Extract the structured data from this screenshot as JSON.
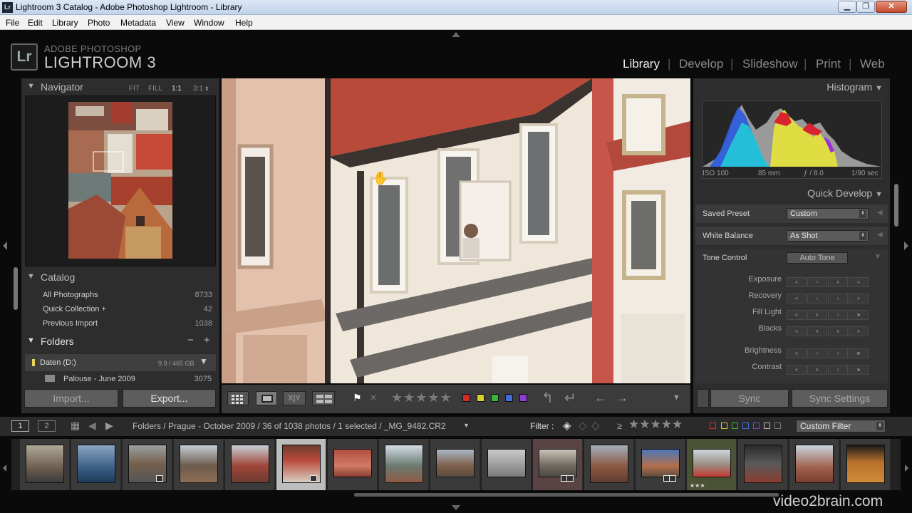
{
  "window": {
    "title": "Lightroom 3 Catalog - Adobe Photoshop Lightroom - Library",
    "app_icon": "Lr",
    "controls": [
      "minimize",
      "maximize",
      "close"
    ]
  },
  "menu": [
    "File",
    "Edit",
    "Library",
    "Photo",
    "Metadata",
    "View",
    "Window",
    "Help"
  ],
  "identity": {
    "badge": "Lr",
    "line1": "ADOBE PHOTOSHOP",
    "line2": "LIGHTROOM 3"
  },
  "modules": [
    "Library",
    "Develop",
    "Slideshow",
    "Print",
    "Web"
  ],
  "active_module": "Library",
  "navigator": {
    "title": "Navigator",
    "options": [
      "FIT",
      "FILL",
      "1:1",
      "3:1"
    ],
    "active_option": "1:1"
  },
  "catalog": {
    "title": "Catalog",
    "items": [
      {
        "label": "All Photographs",
        "count": "8733"
      },
      {
        "label": "Quick Collection  +",
        "count": "42"
      },
      {
        "label": "Previous Import",
        "count": "1038"
      }
    ]
  },
  "folders": {
    "title": "Folders",
    "volume": {
      "label": "Daten (D:)",
      "size": "9.9 / 465 GB"
    },
    "items": [
      {
        "label": "Palouse - June 2009",
        "count": "3075"
      }
    ]
  },
  "left_buttons": {
    "import": "Import...",
    "export": "Export..."
  },
  "right_buttons": {
    "sync": "Sync",
    "sync_settings": "Sync Settings"
  },
  "histogram": {
    "title": "Histogram",
    "iso": "ISO 100",
    "focal": "85 mm",
    "aperture": "ƒ / 8.0",
    "shutter": "1/90 sec"
  },
  "quick_develop": {
    "title": "Quick Develop",
    "saved_preset_label": "Saved Preset",
    "saved_preset_value": "Custom",
    "white_balance_label": "White Balance",
    "white_balance_value": "As Shot",
    "tone_control_label": "Tone Control",
    "auto_tone": "Auto Tone",
    "adjustments": [
      "Exposure",
      "Recovery",
      "Fill Light",
      "Blacks",
      "Brightness",
      "Contrast"
    ]
  },
  "toolbar": {
    "flag_colors": [
      "#d42b2b",
      "#d6d22a",
      "#36b53a",
      "#3f6fd6",
      "#8a3fd6"
    ],
    "stars": "★★★★★"
  },
  "filmstrip_bar": {
    "page1": "1",
    "page2": "2",
    "breadcrumb": "Folders / Prague - October 2009 / 36 of 1038 photos / 1 selected / _MG_9482.CR2",
    "filter_label": "Filter :",
    "filter_preset": "Custom Filter",
    "ge": "≥",
    "stars": "★★★★★"
  },
  "filmstrip": {
    "selected_index": 5,
    "thumb_stars": "★★★"
  },
  "watermark": "video2brain.com"
}
